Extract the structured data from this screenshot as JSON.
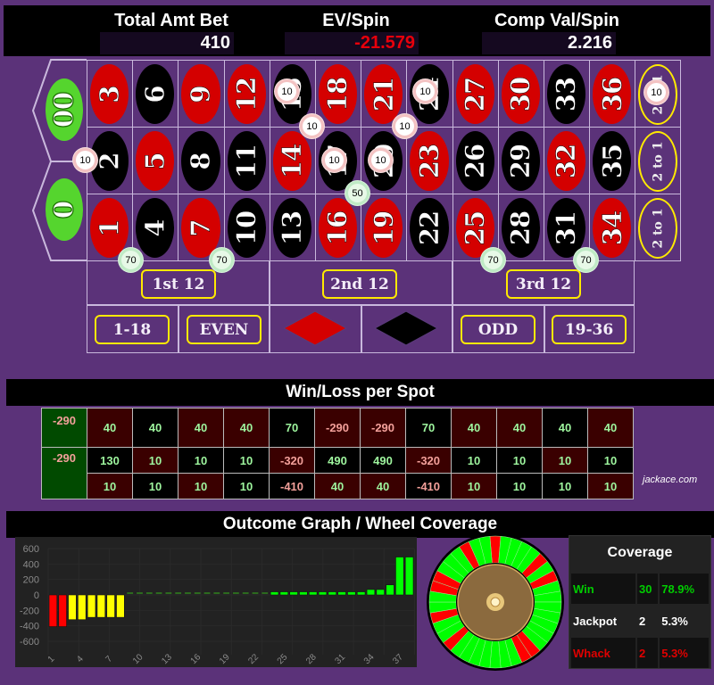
{
  "header": {
    "total_bet_label": "Total Amt Bet",
    "total_bet_value": "410",
    "ev_label": "EV/Spin",
    "ev_value": "-21.579",
    "comp_label": "Comp Val/Spin",
    "comp_value": "2.216"
  },
  "colors": {
    "red": "#d40000",
    "black": "#000000",
    "green": "#55d52e",
    "felt": "#5b3279",
    "negative": "#e8000b"
  },
  "board": {
    "zeros": [
      "00",
      "0"
    ],
    "rows": [
      [
        {
          "n": "3",
          "c": "red"
        },
        {
          "n": "6",
          "c": "black"
        },
        {
          "n": "9",
          "c": "red"
        },
        {
          "n": "12",
          "c": "red"
        },
        {
          "n": "15",
          "c": "black"
        },
        {
          "n": "18",
          "c": "red"
        },
        {
          "n": "21",
          "c": "red"
        },
        {
          "n": "24",
          "c": "black"
        },
        {
          "n": "27",
          "c": "red"
        },
        {
          "n": "30",
          "c": "red"
        },
        {
          "n": "33",
          "c": "black"
        },
        {
          "n": "36",
          "c": "red"
        }
      ],
      [
        {
          "n": "2",
          "c": "black"
        },
        {
          "n": "5",
          "c": "red"
        },
        {
          "n": "8",
          "c": "black"
        },
        {
          "n": "11",
          "c": "black"
        },
        {
          "n": "14",
          "c": "red"
        },
        {
          "n": "17",
          "c": "black"
        },
        {
          "n": "20",
          "c": "black"
        },
        {
          "n": "23",
          "c": "red"
        },
        {
          "n": "26",
          "c": "black"
        },
        {
          "n": "29",
          "c": "black"
        },
        {
          "n": "32",
          "c": "red"
        },
        {
          "n": "35",
          "c": "black"
        }
      ],
      [
        {
          "n": "1",
          "c": "red"
        },
        {
          "n": "4",
          "c": "black"
        },
        {
          "n": "7",
          "c": "red"
        },
        {
          "n": "10",
          "c": "black"
        },
        {
          "n": "13",
          "c": "black"
        },
        {
          "n": "16",
          "c": "red"
        },
        {
          "n": "19",
          "c": "red"
        },
        {
          "n": "22",
          "c": "black"
        },
        {
          "n": "25",
          "c": "red"
        },
        {
          "n": "28",
          "c": "black"
        },
        {
          "n": "31",
          "c": "black"
        },
        {
          "n": "34",
          "c": "red"
        }
      ]
    ],
    "column_bets": [
      "2 to 1",
      "2 to 1",
      "2 to 1"
    ],
    "dozens": [
      "1st 12",
      "2nd 12",
      "3rd 12"
    ],
    "outside": [
      "1-18",
      "EVEN",
      "red",
      "black",
      "ODD",
      "19-36"
    ],
    "chips": [
      {
        "label": "10",
        "bet": "basket 0-00-2"
      },
      {
        "label": "10",
        "bet": "straight 15"
      },
      {
        "label": "10",
        "bet": "straight 24"
      },
      {
        "label": "10",
        "bet": "corner 14-15-17-18"
      },
      {
        "label": "10",
        "bet": "corner 20-21-23-24"
      },
      {
        "label": "10",
        "bet": "straight 17"
      },
      {
        "label": "10",
        "bet": "straight 20"
      },
      {
        "label": "50",
        "bet": "corner 16-17-19-20"
      },
      {
        "label": "10",
        "bet": "column 3"
      },
      {
        "label": "70",
        "bet": "six line 1-6"
      },
      {
        "label": "70",
        "bet": "six line 7-12"
      },
      {
        "label": "70",
        "bet": "six line 25-30"
      },
      {
        "label": "70",
        "bet": "six line 31-36"
      }
    ]
  },
  "winloss": {
    "title": "Win/Loss per Spot",
    "zeros": [
      "-290",
      "-290"
    ],
    "rows": [
      [
        "40",
        "40",
        "40",
        "40",
        "70",
        "-290",
        "-290",
        "70",
        "40",
        "40",
        "40",
        "40"
      ],
      [
        "130",
        "10",
        "10",
        "10",
        "-320",
        "490",
        "490",
        "-320",
        "10",
        "10",
        "10",
        "10"
      ],
      [
        "10",
        "10",
        "10",
        "10",
        "-410",
        "40",
        "40",
        "-410",
        "10",
        "10",
        "10",
        "10"
      ]
    ],
    "brand": "jackace.com"
  },
  "outcome": {
    "title": "Outcome Graph / Wheel Coverage"
  },
  "chart_data": {
    "type": "bar",
    "title": "Outcome Graph",
    "xlabel": "",
    "ylabel": "",
    "ylim": [
      -600,
      600
    ],
    "yticks": [
      "600",
      "400",
      "200",
      "0",
      "-200",
      "-400",
      "-600"
    ],
    "xticks": [
      "1",
      "4",
      "7",
      "10",
      "13",
      "16",
      "19",
      "22",
      "25",
      "28",
      "31",
      "34",
      "37"
    ],
    "values": [
      -410,
      -410,
      -320,
      -320,
      -290,
      -290,
      -290,
      -290,
      10,
      10,
      10,
      10,
      10,
      10,
      10,
      10,
      10,
      10,
      10,
      10,
      10,
      10,
      10,
      40,
      40,
      40,
      40,
      40,
      40,
      40,
      40,
      40,
      40,
      70,
      70,
      130,
      490,
      490
    ],
    "color_rules": {
      "whack": "#ff0000",
      "loss": "#ffff00",
      "push_small": "#2c6a1e",
      "win": "#00ff00"
    }
  },
  "coverage": {
    "title": "Coverage",
    "rows": [
      {
        "label": "Win",
        "count": "30",
        "pct": "78.9%",
        "color": "#00cc00"
      },
      {
        "label": "Jackpot",
        "count": "2",
        "pct": "5.3%",
        "color": "#ffffff"
      },
      {
        "label": "Whack",
        "count": "2",
        "pct": "5.3%",
        "color": "#e00000"
      }
    ],
    "wheel_whack_slots": 6,
    "wheel_total_slots": 38
  }
}
